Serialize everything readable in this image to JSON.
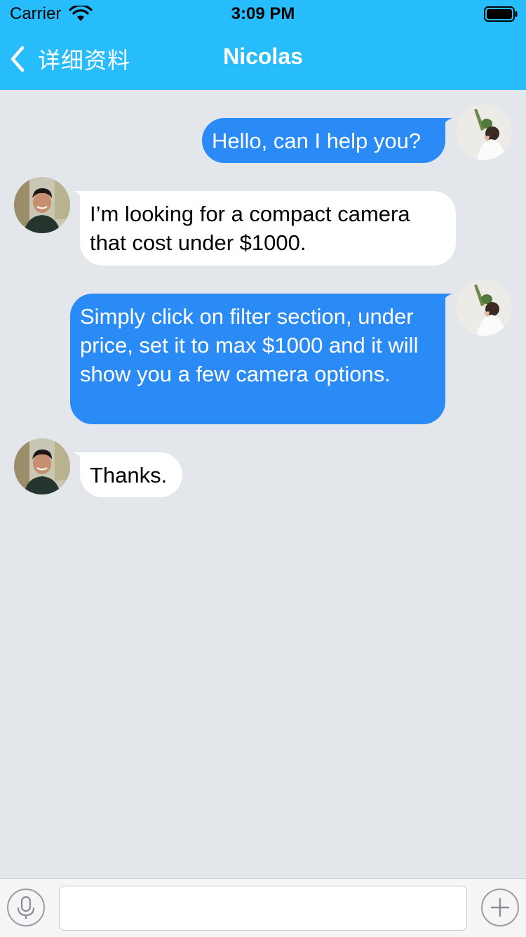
{
  "status_bar": {
    "carrier": "Carrier",
    "time": "3:09 PM",
    "wifi_icon": "wifi-icon",
    "battery_icon": "battery-icon"
  },
  "nav": {
    "back_label": "详细资料",
    "back_icon": "chevron-left-icon",
    "title": "Nicolas"
  },
  "messages": [
    {
      "direction": "outgoing",
      "avatar": "woman-avatar",
      "text": "Hello, can I help you?"
    },
    {
      "direction": "incoming",
      "avatar": "man-avatar",
      "text": "I’m looking for a compact camera that cost under $1000."
    },
    {
      "direction": "outgoing",
      "avatar": "woman-avatar",
      "text": "Simply click on filter section, under price, set it to max $1000 and it will show you a few camera options."
    },
    {
      "direction": "incoming",
      "avatar": "man-avatar",
      "text": "Thanks."
    }
  ],
  "input_bar": {
    "mic_icon": "microphone-icon",
    "text_value": "",
    "placeholder": "",
    "plus_icon": "plus-icon"
  },
  "colors": {
    "header": "#27bdfd",
    "outgoing_bubble": "#2a8af6",
    "incoming_bubble": "#ffffff",
    "chat_background": "#e3e6ea"
  }
}
